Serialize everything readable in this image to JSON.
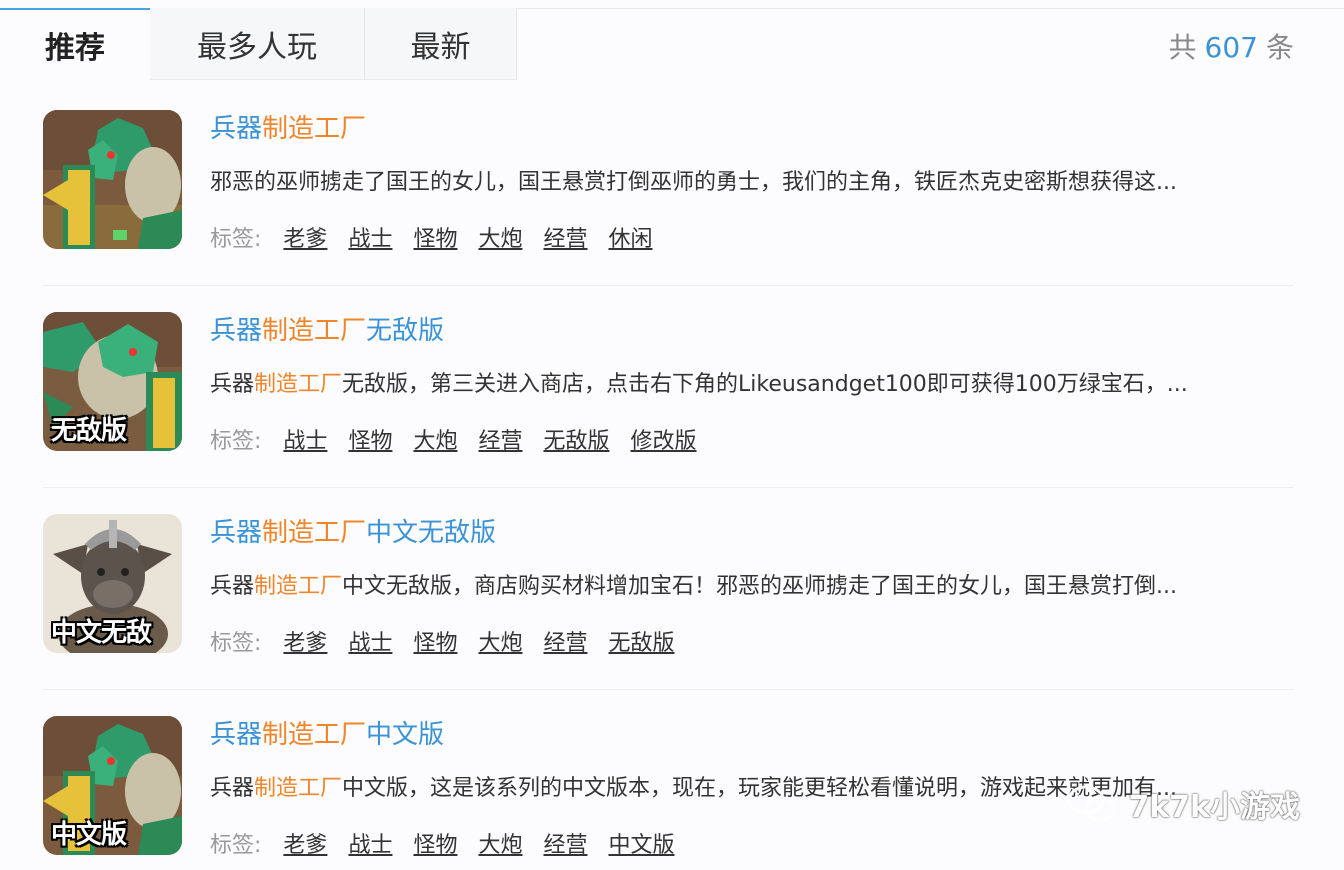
{
  "tabs": [
    {
      "label": "推荐"
    },
    {
      "label": "最多人玩"
    },
    {
      "label": "最新"
    }
  ],
  "total": {
    "prefix": "共",
    "count": "607",
    "suffix": "条"
  },
  "tag_label": "标签:",
  "colors": {
    "accent": "#3b93d6",
    "highlight": "#f0852a"
  },
  "items": [
    {
      "title_pre": "兵器",
      "title_hl": "制造工厂",
      "title_post": "",
      "desc_pre": "邪恶的巫师掳走了国王的女儿，国王悬赏打倒巫师的勇士，我们的主角，铁匠杰克史密斯想获得这...",
      "desc_hl": "",
      "desc_post": "",
      "thumb_label": "",
      "tags": [
        "老爹",
        "战士",
        "怪物",
        "大炮",
        "经营",
        "休闲"
      ]
    },
    {
      "title_pre": "兵器",
      "title_hl": "制造工厂",
      "title_post": "无敌版",
      "desc_pre": "兵器",
      "desc_hl": "制造工厂",
      "desc_post": "无敌版，第三关进入商店，点击右下角的Likeusandget100即可获得100万绿宝石，...",
      "thumb_label": "无敌版",
      "tags": [
        "战士",
        "怪物",
        "大炮",
        "经营",
        "无敌版",
        "修改版"
      ]
    },
    {
      "title_pre": "兵器",
      "title_hl": "制造工厂",
      "title_post": "中文无敌版",
      "desc_pre": "兵器",
      "desc_hl": "制造工厂",
      "desc_post": "中文无敌版，商店购买材料增加宝石！邪恶的巫师掳走了国王的女儿，国王悬赏打倒...",
      "thumb_label": "中文无敌",
      "tags": [
        "老爹",
        "战士",
        "怪物",
        "大炮",
        "经营",
        "无敌版"
      ]
    },
    {
      "title_pre": "兵器",
      "title_hl": "制造工厂",
      "title_post": "中文版",
      "desc_pre": "兵器",
      "desc_hl": "制造工厂",
      "desc_post": "中文版，这是该系列的中文版本，现在，玩家能更轻松看懂说明，游戏起来就更加有...",
      "thumb_label": "中文版",
      "tags": [
        "老爹",
        "战士",
        "怪物",
        "大炮",
        "经营",
        "中文版"
      ]
    }
  ],
  "watermark": {
    "text": "7k7k小游戏"
  }
}
